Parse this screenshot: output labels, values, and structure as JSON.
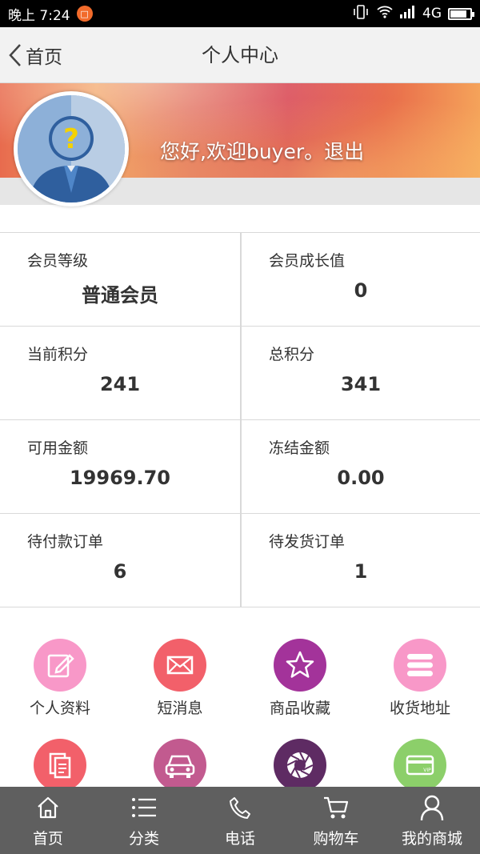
{
  "status_bar": {
    "time": "晚上 7:24",
    "network": "4G",
    "notification_badge": "□",
    "battery_level": 0.85
  },
  "header": {
    "back_label": "首页",
    "title": "个人中心"
  },
  "profile": {
    "greeting": "您好,欢迎buyer。",
    "logout_label": "退出"
  },
  "stats": [
    {
      "label": "会员等级",
      "value": "普通会员"
    },
    {
      "label": "会员成长值",
      "value": "0"
    },
    {
      "label": "当前积分",
      "value": "241"
    },
    {
      "label": "总积分",
      "value": "341"
    },
    {
      "label": "可用金额",
      "value": "19969.70"
    },
    {
      "label": "冻结金额",
      "value": "0.00"
    },
    {
      "label": "待付款订单",
      "value": "6"
    },
    {
      "label": "待发货订单",
      "value": "1"
    }
  ],
  "menu": [
    {
      "label": "个人资料",
      "icon": "edit-icon",
      "color": "#f898c8"
    },
    {
      "label": "短消息",
      "icon": "envelope-icon",
      "color": "#f2606a"
    },
    {
      "label": "商品收藏",
      "icon": "star-icon",
      "color": "#a3339a"
    },
    {
      "label": "收货地址",
      "icon": "list-icon",
      "color": "#f898c8"
    },
    {
      "label": "",
      "icon": "document-icon",
      "color": "#f2606a"
    },
    {
      "label": "",
      "icon": "car-icon",
      "color": "#c25a8f"
    },
    {
      "label": "",
      "icon": "aperture-icon",
      "color": "#5e2b63"
    },
    {
      "label": "",
      "icon": "vip-card-icon",
      "color": "#8ccf6a"
    }
  ],
  "bottom_nav": [
    {
      "label": "首页",
      "icon": "home-icon"
    },
    {
      "label": "分类",
      "icon": "list-icon"
    },
    {
      "label": "电话",
      "icon": "phone-icon"
    },
    {
      "label": "购物车",
      "icon": "cart-icon"
    },
    {
      "label": "我的商城",
      "icon": "user-icon"
    }
  ]
}
